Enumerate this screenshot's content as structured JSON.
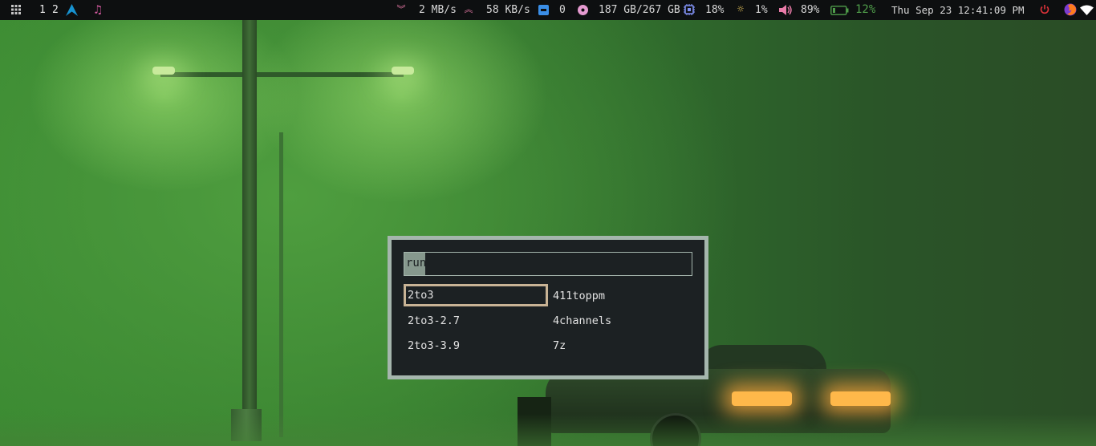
{
  "topbar": {
    "menu_icon": "grid-icon",
    "workspaces": [
      "1",
      "2"
    ],
    "distro_icon": "arch-linux-icon",
    "music_icon": "music-note-icon",
    "download": {
      "icon": "download-arrows-icon",
      "value": "2 MB/s"
    },
    "upload": {
      "icon": "upload-arrows-icon",
      "value": "58 KB/s"
    },
    "updates": {
      "icon": "package-icon",
      "value": "0"
    },
    "disk": {
      "icon": "disk-icon",
      "value": "187 GB/267 GB"
    },
    "cpu": {
      "icon": "cpu-chip-icon",
      "value": "18%"
    },
    "brightness": {
      "icon": "brightness-icon",
      "value": "1%"
    },
    "volume": {
      "icon": "speaker-icon",
      "value": "89%"
    },
    "battery": {
      "icon": "battery-icon",
      "value": "12%"
    },
    "clock": "Thu Sep 23 12:41:09 PM",
    "power_icon": "power-icon",
    "firefox_icon": "firefox-icon",
    "wifi_icon": "wifi-icon",
    "colors": {
      "bar_bg": "#0d0f10",
      "arch_blue": "#1793d1",
      "music_pink": "#d45aa0",
      "net_accent": "#e97ba8",
      "updates_blue": "#3a8ee6",
      "battery_green": "#4f9d4a",
      "power_red": "#e0333a"
    }
  },
  "launcher": {
    "prompt": "run",
    "input_value": "",
    "entries": [
      {
        "label": "2to3",
        "selected": true
      },
      {
        "label": "411toppm",
        "selected": false
      },
      {
        "label": "2to3-2.7",
        "selected": false
      },
      {
        "label": "4channels",
        "selected": false
      },
      {
        "label": "2to3-3.9",
        "selected": false
      },
      {
        "label": "7z",
        "selected": false
      }
    ],
    "colors": {
      "border": "#a5b6ad",
      "background": "#1c2123",
      "selected_border": "#c8b395"
    }
  }
}
